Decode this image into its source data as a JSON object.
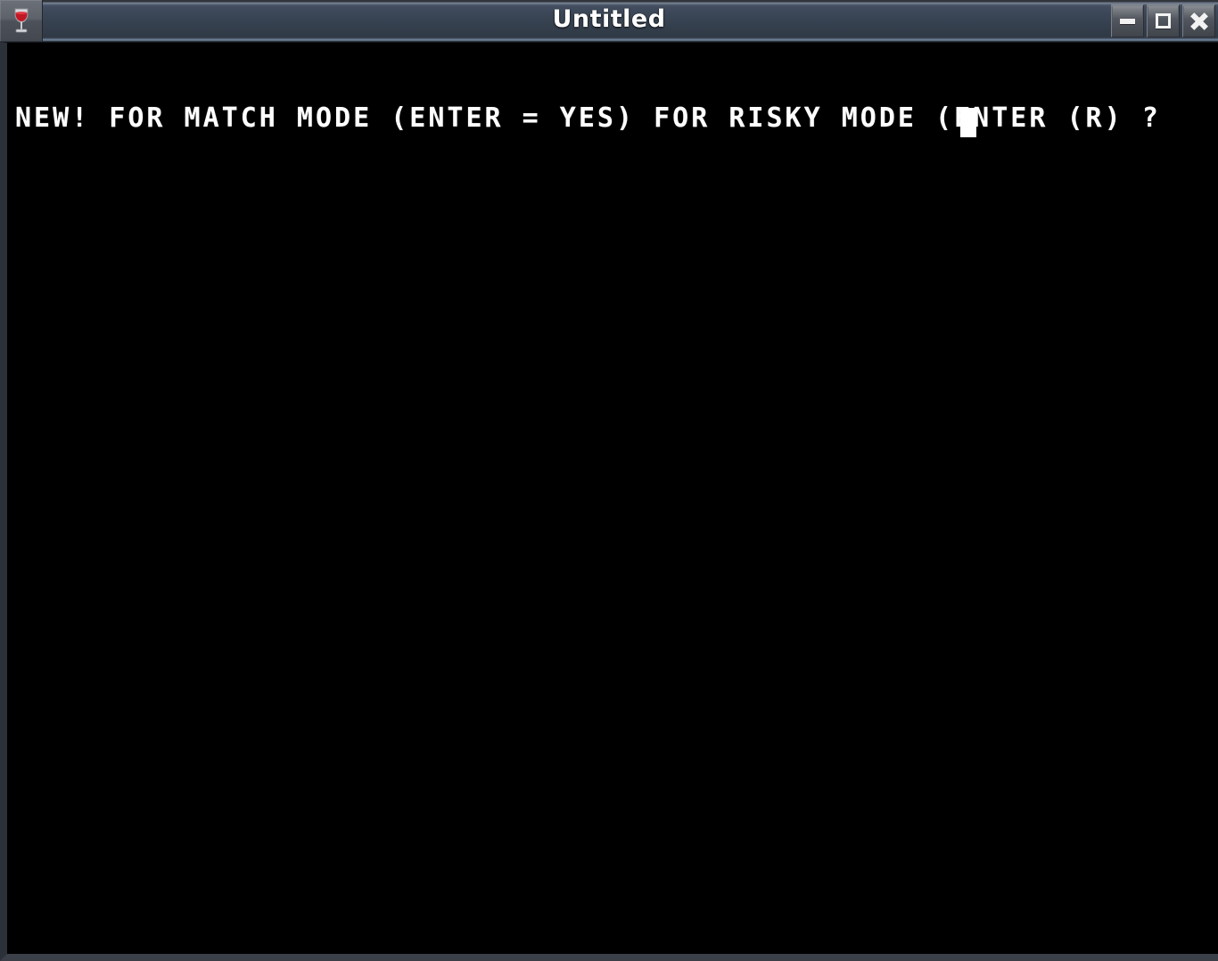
{
  "window": {
    "title": "Untitled",
    "system_menu_icon": "wine-glass-icon",
    "controls": {
      "minimize_label": "Minimize",
      "maximize_label": "Maximize",
      "close_label": "Close",
      "minimize_icon": "minimize-icon",
      "maximize_icon": "maximize-icon",
      "close_icon": "close-icon"
    }
  },
  "terminal": {
    "background_color": "#000000",
    "foreground_color": "#ffffff",
    "lines": [
      "NEW! FOR MATCH MODE (ENTER = YES) FOR RISKY MODE (ENTER (R) ?"
    ],
    "prompt_text": "NEW! FOR MATCH MODE (ENTER = YES) FOR RISKY MODE (ENTER (R) ?",
    "cursor": {
      "type": "block",
      "visible": true,
      "color": "#ffffff"
    },
    "input_value": ""
  },
  "theme": {
    "titlebar_gradient_top": "#3c4858",
    "titlebar_gradient_bottom": "#2f3845",
    "titlebar_highlight": "#7b8ea6",
    "title_color": "#ffffff",
    "border_color": "#2c3038",
    "button_face": "#4e525a"
  }
}
